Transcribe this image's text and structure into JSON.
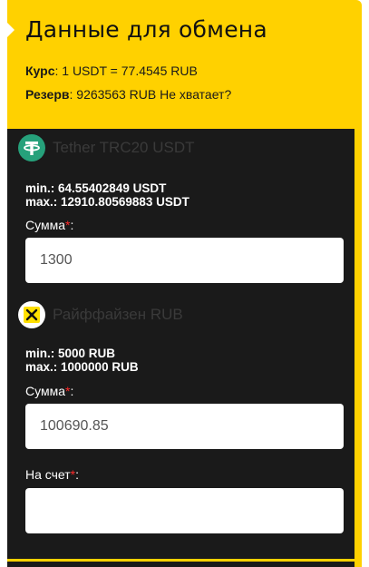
{
  "header": {
    "title": "Данные для обмена",
    "rate_label": "Курс",
    "rate_value": ": 1 USDT = 77.4545 RUB",
    "reserve_label": "Резерв",
    "reserve_value": ": 9263563 RUB ",
    "reserve_link": "Не хватает?"
  },
  "give": {
    "currency_name": "Tether TRC20 USDT",
    "icon": "tether-icon",
    "min": "min.: 64.55402849 USDT",
    "max": "max.: 12910.80569883 USDT",
    "amount_label": "Сумма",
    "amount_value": "1300"
  },
  "get": {
    "currency_name": "Райффайзен RUB",
    "icon": "raiffeisen-icon",
    "min": "min.: 5000 RUB",
    "max": "max.: 1000000 RUB",
    "amount_label": "Сумма",
    "amount_value": "100690.85",
    "account_label": "На счет",
    "account_value": ""
  },
  "required_mark": "*",
  "colon": ":",
  "colors": {
    "accent": "#ffd100",
    "panel_dark": "#1a1a1a",
    "required": "#ff2a2a",
    "tether_green": "#26a17b"
  }
}
